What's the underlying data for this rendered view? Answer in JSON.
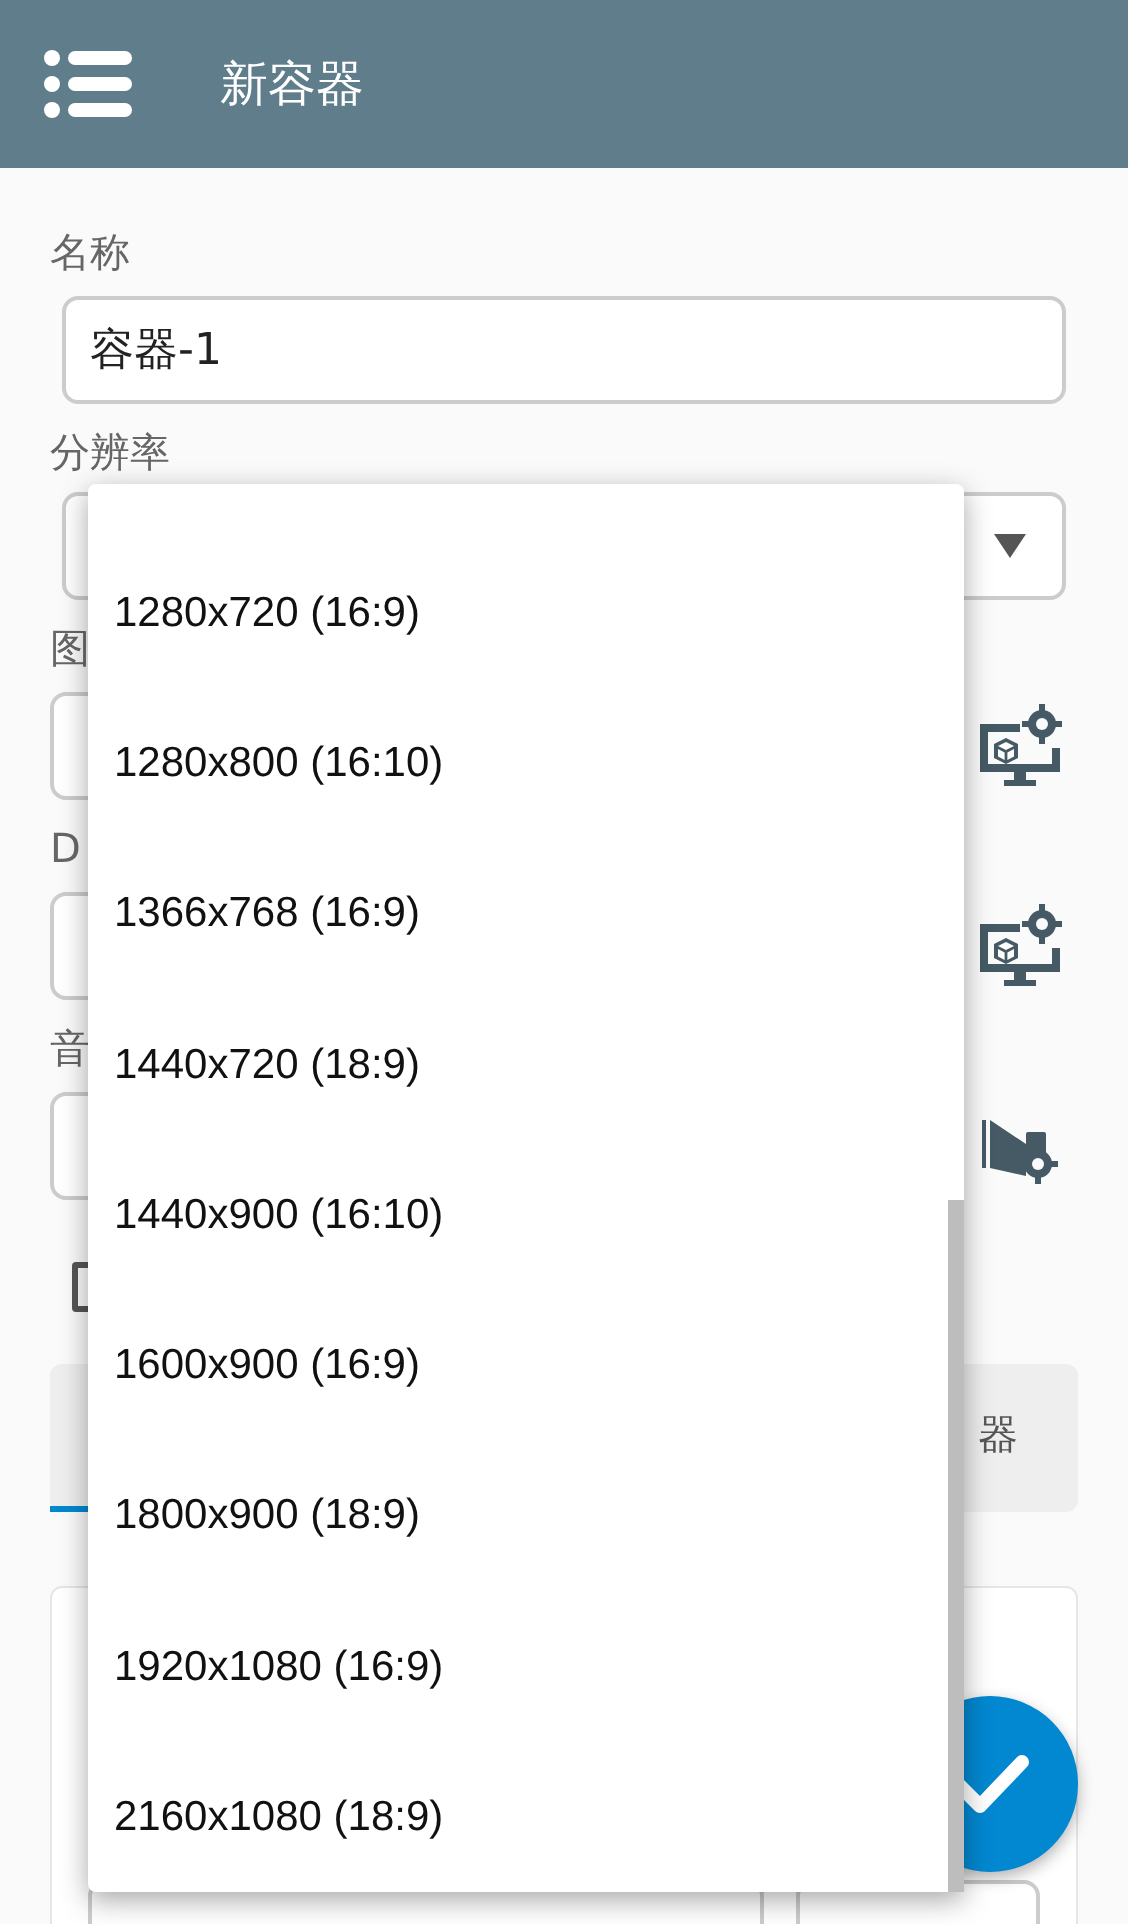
{
  "app_bar": {
    "title": "新容器"
  },
  "fields": [
    {
      "kind": "text",
      "label": "名称",
      "value": "容器-1"
    },
    {
      "kind": "select",
      "label": "分辨率"
    },
    {
      "kind": "display",
      "label": "图"
    },
    {
      "kind": "display",
      "label": "D"
    },
    {
      "kind": "audio",
      "label": "音"
    }
  ],
  "checkbox": {
    "checked": false
  },
  "tabs": [
    {
      "selected": true
    },
    {
      "label": "器",
      "selected": false
    }
  ],
  "dropdown": {
    "options": [
      "1280x720 (16:9)",
      "1280x800 (16:10)",
      "1366x768 (16:9)",
      "1440x720 (18:9)",
      "1440x900 (16:10)",
      "1600x900 (16:9)",
      "1800x900 (18:9)",
      "1920x1080 (16:9)",
      "2160x1080 (18:9)"
    ]
  }
}
